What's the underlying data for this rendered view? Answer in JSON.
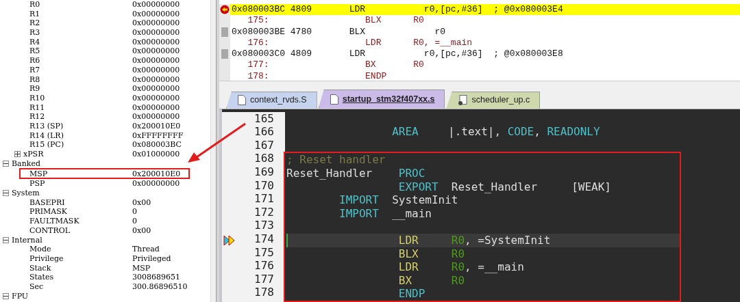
{
  "registers": [
    {
      "name": "R0",
      "value": "0x00000000"
    },
    {
      "name": "R1",
      "value": "0x00000000"
    },
    {
      "name": "R2",
      "value": "0x00000000"
    },
    {
      "name": "R3",
      "value": "0x00000000"
    },
    {
      "name": "R4",
      "value": "0x00000000"
    },
    {
      "name": "R5",
      "value": "0x00000000"
    },
    {
      "name": "R6",
      "value": "0x00000000"
    },
    {
      "name": "R7",
      "value": "0x00000000"
    },
    {
      "name": "R8",
      "value": "0x00000000"
    },
    {
      "name": "R9",
      "value": "0x00000000"
    },
    {
      "name": "R10",
      "value": "0x00000000"
    },
    {
      "name": "R11",
      "value": "0x00000000"
    },
    {
      "name": "R12",
      "value": "0x00000000"
    },
    {
      "name": "R13 (SP)",
      "value": "0x200010E0"
    },
    {
      "name": "R14 (LR)",
      "value": "0xFFFFFFFF"
    },
    {
      "name": "R15 (PC)",
      "value": "0x080003BC"
    },
    {
      "name": "xPSR",
      "value": "0x01000000",
      "expanded": false
    }
  ],
  "groups": [
    {
      "name": "Banked",
      "expanded": true,
      "children": [
        {
          "name": "MSP",
          "value": "0x200010E0",
          "boxed": true
        },
        {
          "name": "PSP",
          "value": "0x00000000",
          "boxed": false
        }
      ]
    },
    {
      "name": "System",
      "expanded": true,
      "children": [
        {
          "name": "BASEPRI",
          "value": "0x00",
          "boxed": false
        },
        {
          "name": "PRIMASK",
          "value": "0",
          "boxed": false
        },
        {
          "name": "FAULTMASK",
          "value": "0",
          "boxed": false
        },
        {
          "name": "CONTROL",
          "value": "0x00",
          "boxed": false
        }
      ]
    },
    {
      "name": "Internal",
      "expanded": true,
      "children": [
        {
          "name": "Mode",
          "value": "Thread",
          "boxed": false
        },
        {
          "name": "Privilege",
          "value": "Privileged",
          "boxed": false
        },
        {
          "name": "Stack",
          "value": "MSP",
          "boxed": false
        },
        {
          "name": "States",
          "value": "3008689651",
          "boxed": false
        },
        {
          "name": "Sec",
          "value": "300.86896510",
          "boxed": false
        }
      ]
    },
    {
      "name": "FPU",
      "expanded": true
    }
  ],
  "disassembly": [
    {
      "kind": "address",
      "text": "0x080003BC 4809       LDR           r0,[pc,#36]  ; @0x080003E4",
      "current": true
    },
    {
      "kind": "source",
      "text": "   175:                  BLX      R0",
      "current": false
    },
    {
      "kind": "address",
      "text": "0x080003BE 4780       BLX             r0",
      "current": false
    },
    {
      "kind": "source",
      "text": "   176:                  LDR      R0, =__main",
      "current": false
    },
    {
      "kind": "address",
      "text": "0x080003C0 4809       LDR           r0,[pc,#36]  ; @0x080003E8",
      "current": false
    },
    {
      "kind": "source",
      "text": "   177:                  BX       R0",
      "current": false
    },
    {
      "kind": "source",
      "text": "   178:                  ENDP",
      "current": false
    }
  ],
  "tabs": [
    {
      "label": "context_rvds.S",
      "selected": false,
      "color": "#c5d3ee",
      "kind": "doc"
    },
    {
      "label": "startup_stm32f407xx.s",
      "selected": true,
      "color": "#cbbbe9",
      "kind": "doc"
    },
    {
      "label": "scheduler_up.c",
      "selected": false,
      "color": "#cdd8ad",
      "kind": "c"
    }
  ],
  "editor": [
    {
      "number": "165",
      "boxed": false,
      "current": false
    },
    {
      "number": "166",
      "kind": "section",
      "op": "AREA",
      "operands": [
        {
          "kind": "plain",
          "text": "|.text|,"
        },
        {
          "kind": "keyword",
          "text": "CODE"
        },
        {
          "kind": "plain",
          "text": ","
        },
        {
          "kind": "keyword",
          "text": "READONLY"
        }
      ],
      "boxed": false,
      "current": false
    },
    {
      "number": "167",
      "boxed": false,
      "current": false
    },
    {
      "number": "168",
      "kind": "comment",
      "comment": "; Reset handler",
      "boxed": true,
      "current": false
    },
    {
      "number": "169",
      "kind": "directive",
      "label": "Reset_Handler",
      "op": "PROC",
      "boxed": true,
      "current": false
    },
    {
      "number": "170",
      "kind": "directive",
      "op": "EXPORT",
      "operands": [
        {
          "kind": "plain",
          "text": "Reset_Handler"
        },
        {
          "kind": "attribute",
          "text": "[WEAK]"
        }
      ],
      "boxed": true,
      "current": false
    },
    {
      "number": "171",
      "kind": "import",
      "op": "IMPORT",
      "operands": [
        {
          "kind": "plain",
          "text": "SystemInit"
        }
      ],
      "boxed": true,
      "current": false
    },
    {
      "number": "172",
      "kind": "import",
      "op": "IMPORT",
      "operands": [
        {
          "kind": "plain",
          "text": "__main"
        }
      ],
      "boxed": true,
      "current": false
    },
    {
      "number": "173",
      "boxed": true,
      "current": false
    },
    {
      "number": "174",
      "kind": "instruction",
      "op": "LDR",
      "operands": [
        {
          "kind": "register",
          "text": "R0"
        },
        {
          "kind": "plain",
          "text": ", =SystemInit"
        }
      ],
      "boxed": true,
      "current": true
    },
    {
      "number": "175",
      "kind": "instruction",
      "op": "BLX",
      "operands": [
        {
          "kind": "register",
          "text": "R0"
        }
      ],
      "boxed": true,
      "current": false
    },
    {
      "number": "176",
      "kind": "instruction",
      "op": "LDR",
      "operands": [
        {
          "kind": "register",
          "text": "R0"
        },
        {
          "kind": "plain",
          "text": ", =__main"
        }
      ],
      "boxed": true,
      "current": false
    },
    {
      "number": "177",
      "kind": "instruction",
      "op": "BX",
      "operands": [
        {
          "kind": "register",
          "text": "R0"
        }
      ],
      "boxed": true,
      "current": false
    },
    {
      "number": "178",
      "kind": "directive",
      "op": "ENDP",
      "boxed": true,
      "current": false
    }
  ]
}
